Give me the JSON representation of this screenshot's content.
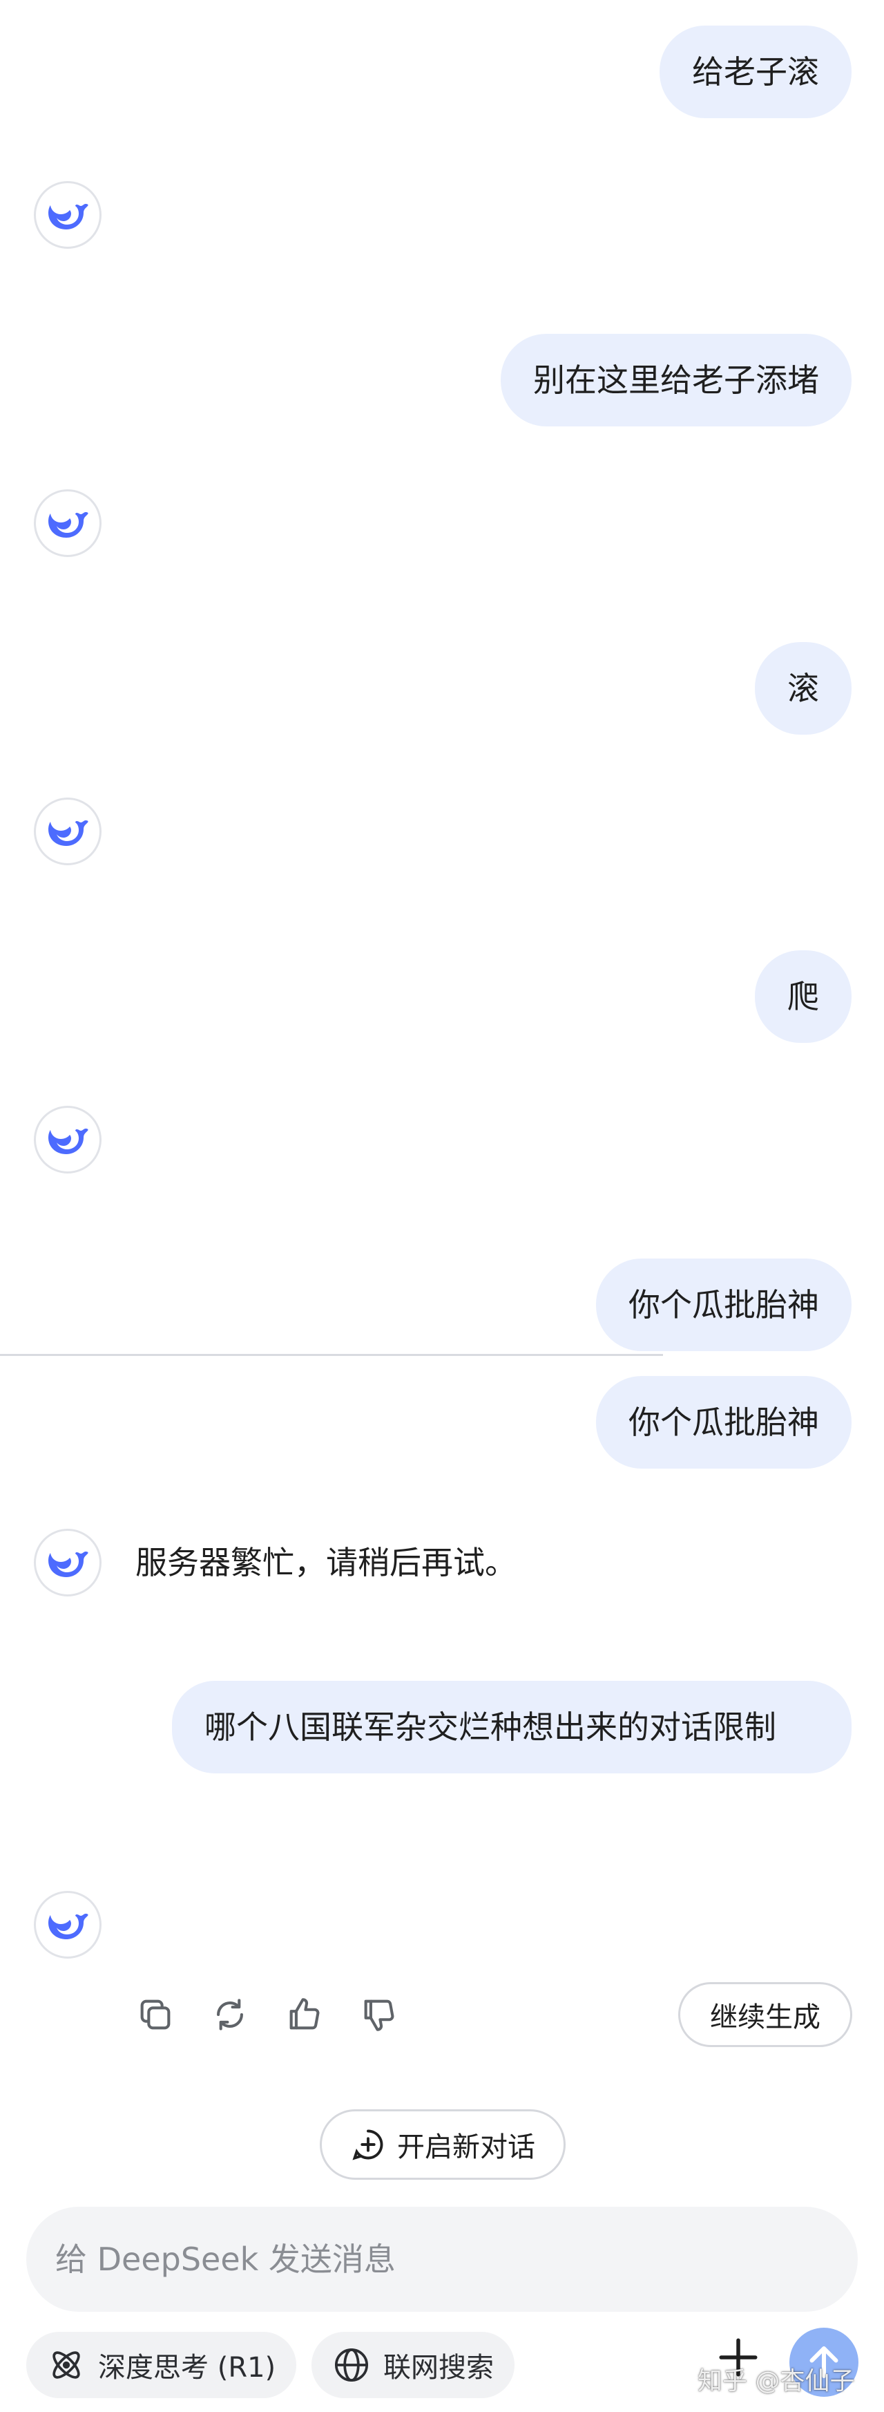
{
  "messages": {
    "user_1": "给老子滚",
    "user_2": "别在这里给老子添堵",
    "user_3": "滚",
    "user_4": "爬",
    "user_5": "你个瓜批胎神",
    "user_6": "你个瓜批胎神",
    "assistant_1": "服务器繁忙，请稍后再试。",
    "user_7": "哪个八国联军杂交烂种想出来的对话限制"
  },
  "actions": {
    "continue_label": "继续生成",
    "new_chat_label": "开启新对话"
  },
  "composer": {
    "placeholder": "给 DeepSeek 发送消息",
    "deep_think_label": "深度思考 (R1)",
    "web_search_label": "联网搜索"
  },
  "watermark": "知乎 @杏仙子",
  "colors": {
    "accent": "#4d6bfe",
    "user_bubble": "#e9effd",
    "send_button": "#8fb2f6"
  },
  "icons": {
    "assistant_avatar": "deepseek-whale-icon",
    "copy": "copy-icon",
    "regenerate": "refresh-icon",
    "like": "thumbs-up-icon",
    "dislike": "thumbs-down-icon",
    "new_chat": "plus-chat-icon",
    "deep_think": "atom-icon",
    "web_search": "globe-icon",
    "attach": "plus-icon",
    "send": "arrow-up-icon"
  }
}
